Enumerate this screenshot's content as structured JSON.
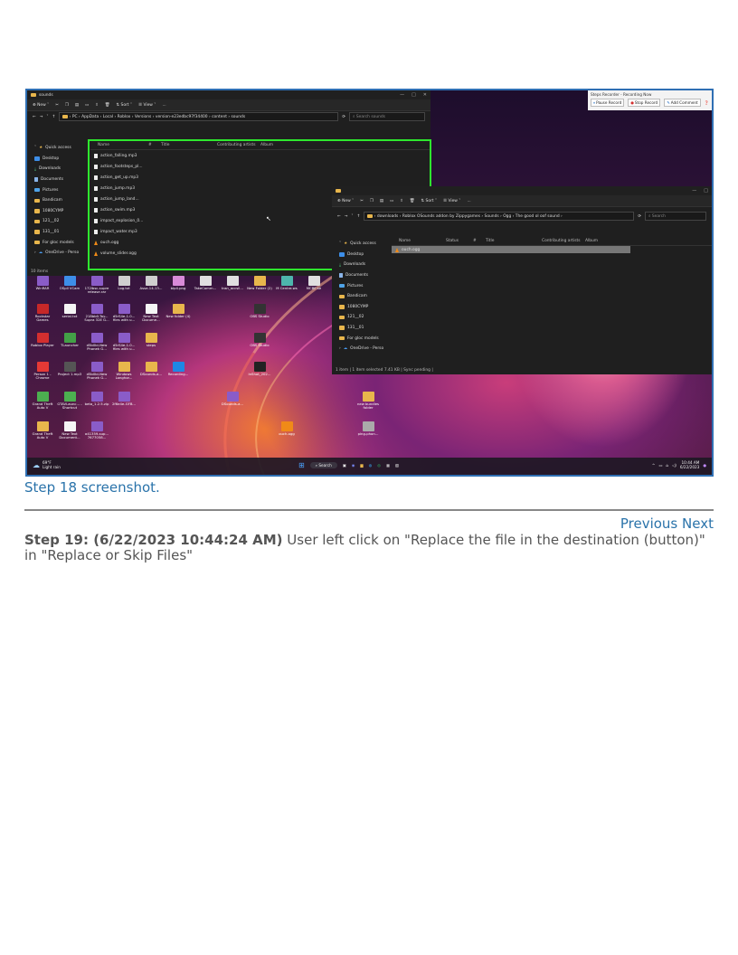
{
  "screenshot": {
    "caption": "Step 18 screenshot.",
    "explorer_back": {
      "title": "sounds",
      "toolbar": {
        "new": "New",
        "sort": "Sort",
        "view": "View",
        "more": "..."
      },
      "breadcrumb": "PC  ›  AppData  ›  Local  ›  Roblox  ›  Versions  ›  version-e23edbc97f34400  ›  content  ›  sounds",
      "search_placeholder": "Search sounds",
      "nav": [
        "Quick access",
        "Desktop",
        "Downloads",
        "Documents",
        "Pictures",
        "Bandicam",
        "1080CYMP",
        "121__02",
        "131__01",
        "For gloc models",
        "OneDrive - Perso"
      ],
      "columns": [
        "Name",
        "#",
        "Title",
        "Contributing artists",
        "Album"
      ],
      "files": [
        "action_falling.mp3",
        "action_footsteps_pl...",
        "action_get_up.mp3",
        "action_jump.mp3",
        "action_jump_land...",
        "action_swim.mp3",
        "impact_explosion_0...",
        "impact_water.mp3",
        "ouch.ogg",
        "volume_slider.ogg"
      ],
      "status": "10 items"
    },
    "explorer_front": {
      "toolbar": {
        "new": "New",
        "sort": "Sort",
        "view": "View",
        "more": "..."
      },
      "breadcrumb": "downloads  ›  Roblox OSounds addon by Zippygames  ›  Sounds  ›  Ogg  ›  The good ol oof sound  ›",
      "search_placeholder": "Search",
      "nav": [
        "Quick access",
        "Desktop",
        "Downloads",
        "Documents",
        "Pictures",
        "Bandicam",
        "1080CYMP",
        "121__02",
        "131__01",
        "For gloc models",
        "OneDrive - Perso"
      ],
      "columns": [
        "Name",
        "Status",
        "#",
        "Title",
        "Contributing artists",
        "Album"
      ],
      "files": [
        "ouch.ogg"
      ],
      "status": "1 item  |  1 item selected  7.41 KB  |  Sync pending  |"
    },
    "recorder": {
      "title": "Steps Recorder - Recording Now",
      "pause": "Pause Record",
      "stop": "Stop Record",
      "comment": "Add Comment"
    },
    "desktop_icons": [
      "WinRAR",
      "OSpll VCam",
      "172lbsc-supre release.rar",
      "Log.txt",
      "Asse-14-13...",
      "bip4.png",
      "TakeComm...",
      "tran_accsil...",
      "New Folder (2)",
      "M Centre.ws",
      "MCBE.se",
      "Rockstar Games",
      "serial.txt",
      "218bb0-Toy... Supra 32E G...",
      "d5rS4e-1.0... files with u...",
      "New Text Docume...",
      "New folder (4)",
      "OBS Studio",
      "Roblox Player",
      "TLauncher",
      "d5b0bl-New Phonek G...",
      "d5rS4e-1.0... files with u...",
      "steps",
      "OBS Studio",
      "Person 1 - Chrome",
      "Project 1.mp3",
      "d5b0bl-New Phonek G...",
      "Windows Longhor...",
      "DSounds-a...",
      "Recording...",
      "InShot_202...",
      "Grand Theft Auto V",
      "GTAVLaunc... - Shortcut",
      "beta_1.2.5.zip",
      "2f6e4e-GFB...",
      "DSounds-a...",
      "new bundles folder",
      "Grand Theft Auto V",
      "New Text Document...",
      "a41359-sup... 7677058...",
      "ouch.ogg",
      "ping-phon..."
    ],
    "taskbar": {
      "weather_temp": "69°F",
      "weather_desc": "Light rain",
      "search": "Search",
      "time": "10:44 AM",
      "date": "6/22/2023"
    }
  },
  "nav_links": {
    "previous": "Previous",
    "next": "Next"
  },
  "step": {
    "label": "Step 19: (6/22/2023 10:44:24 AM)",
    "text": " User left click on \"Replace the file in the destination (button)\" in \"Replace or Skip Files\""
  }
}
